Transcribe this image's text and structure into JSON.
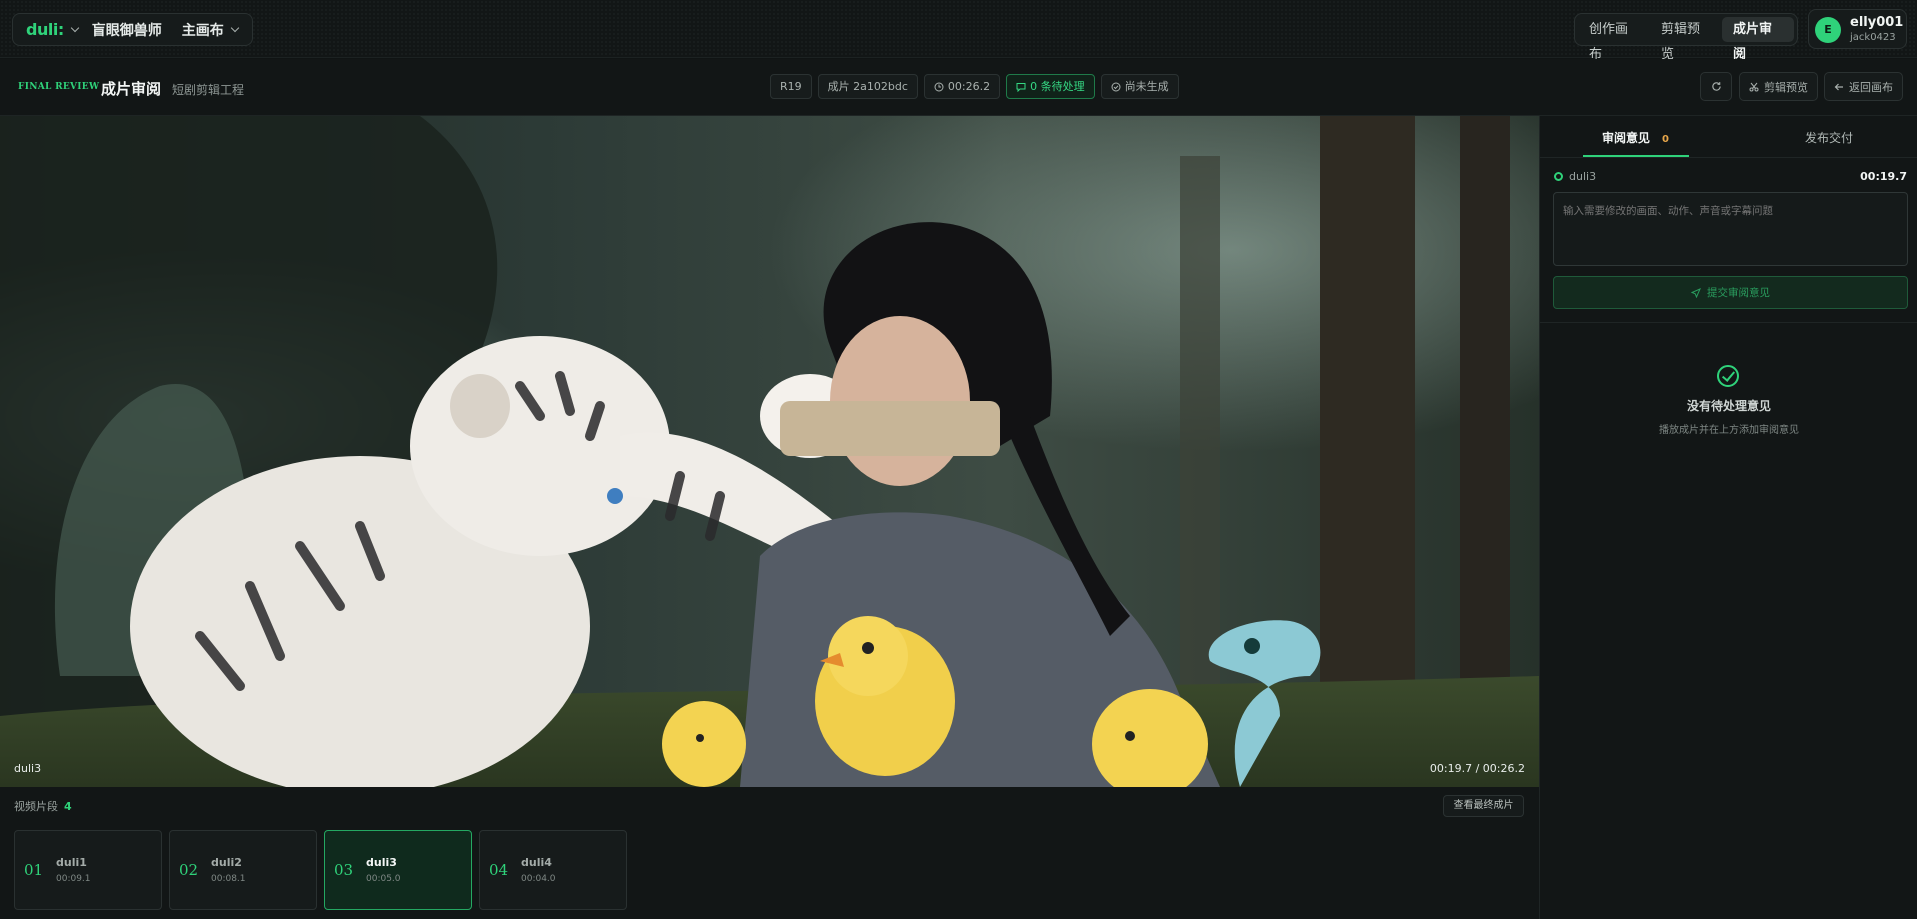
{
  "topbar": {
    "logo": "duli:",
    "project": "盲眼御兽师",
    "canvas_menu": "主画布",
    "tabs": [
      {
        "label": "创作画布",
        "active": false
      },
      {
        "label": "剪辑预览",
        "active": false
      },
      {
        "label": "成片审阅",
        "active": true
      }
    ],
    "user": {
      "initial": "E",
      "name": "elly001",
      "id": "jack0423"
    }
  },
  "subbar": {
    "eyebrow": "FINAL REVIEW",
    "title": "成片审阅",
    "subtitle": "短剧剪辑工程",
    "chips": {
      "round": "R19",
      "cut": "成片 2a102bdc",
      "duration": "00:26.2",
      "pending": "0 条待处理",
      "status": "尚未生成"
    },
    "btn_edit_preview": "剪辑预览",
    "btn_back": "返回画布"
  },
  "video": {
    "clip_label": "duli3",
    "time": "00:19.7 / 00:26.2"
  },
  "clips": {
    "header": "视频片段",
    "count": "4",
    "final_button": "查看最终成片",
    "items": [
      {
        "num": "01",
        "name": "duli1",
        "dur": "00:09.1",
        "active": false
      },
      {
        "num": "02",
        "name": "duli2",
        "dur": "00:08.1",
        "active": false
      },
      {
        "num": "03",
        "name": "duli3",
        "dur": "00:05.0",
        "active": true
      },
      {
        "num": "04",
        "name": "duli4",
        "dur": "00:04.0",
        "active": false
      }
    ]
  },
  "panel": {
    "tab_review": "审阅意见",
    "review_count": "0",
    "tab_publish": "发布交付",
    "clip": "duli3",
    "time": "00:19.7",
    "placeholder": "输入需要修改的画面、动作、声音或字幕问题",
    "submit": "提交审阅意见",
    "empty_title": "没有待处理意见",
    "empty_sub": "播放成片并在上方添加审阅意见"
  },
  "colors": {
    "accent": "#2fd27a",
    "warning": "#e7a64a",
    "background": "#101414"
  }
}
